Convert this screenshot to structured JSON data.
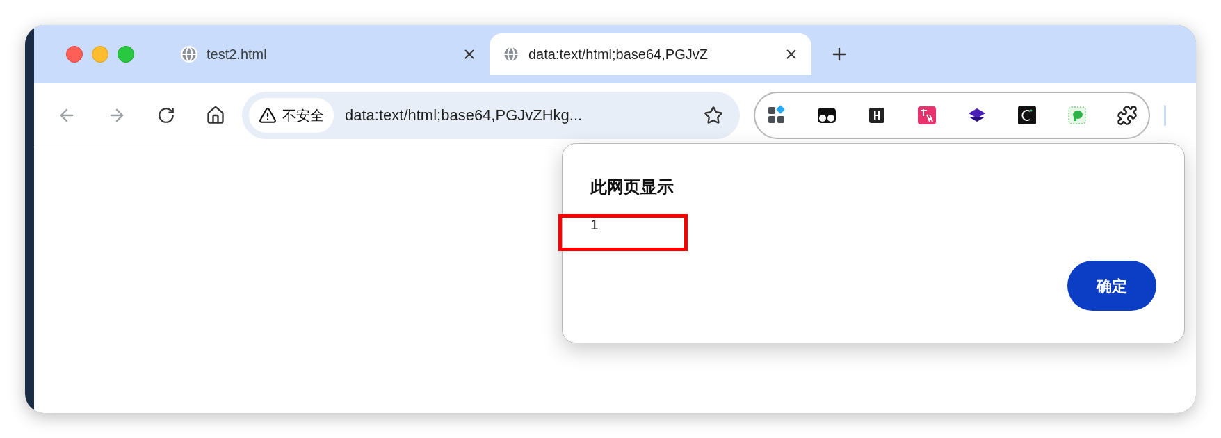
{
  "tabs": [
    {
      "title": "test2.html",
      "selected": false
    },
    {
      "title": "data:text/html;base64,PGJvZ",
      "selected": true
    }
  ],
  "toolbar": {
    "security_chip": "不安全",
    "address": "data:text/html;base64,PGJvZHkg..."
  },
  "dialog": {
    "title": "此网页显示",
    "message": "1",
    "button": "确定",
    "message_highlighted": true
  }
}
